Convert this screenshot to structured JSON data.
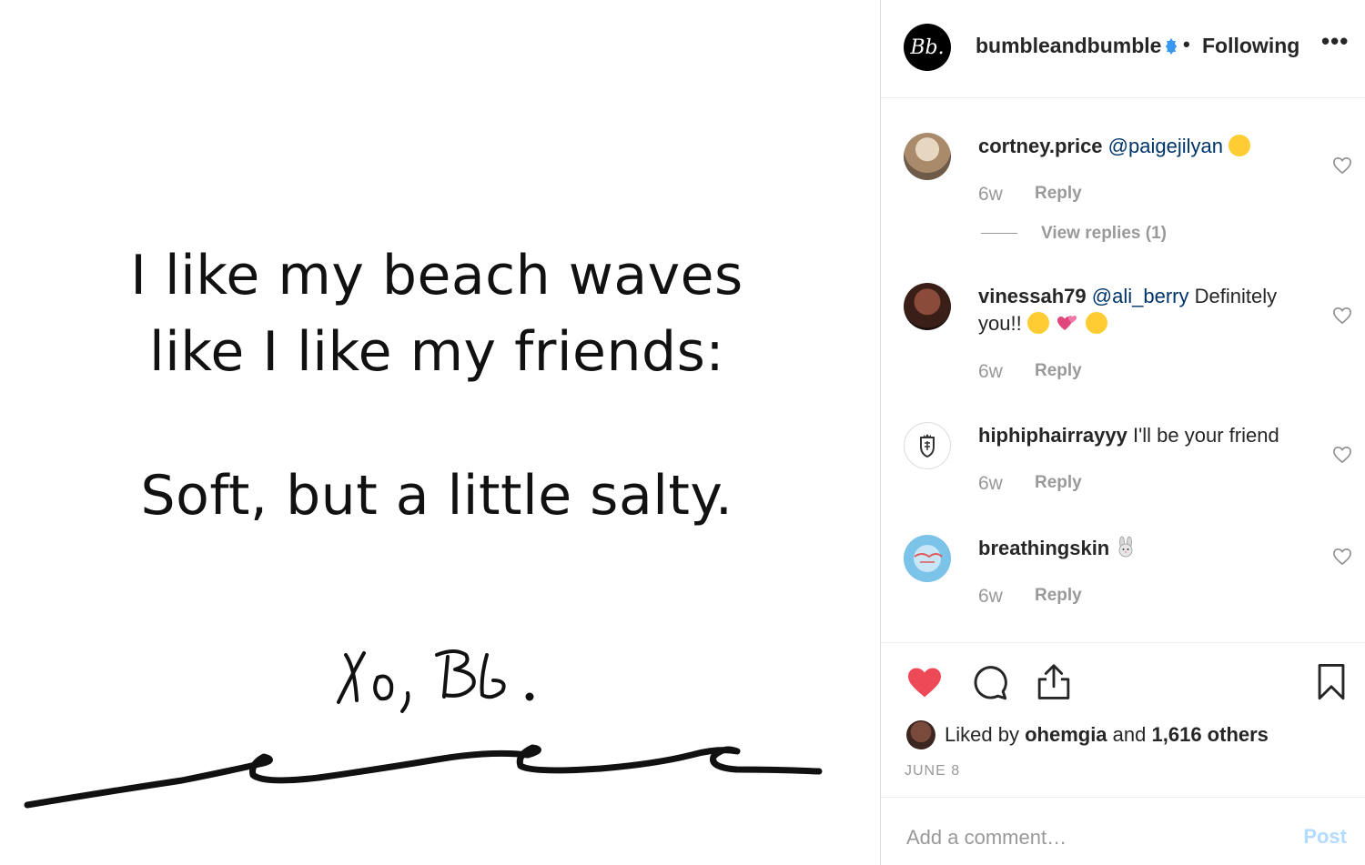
{
  "post_image": {
    "line1": "I like my beach waves",
    "line2": "like I like my friends:",
    "line3": "Soft, but a little salty.",
    "signature": "Xo, Bb."
  },
  "header": {
    "avatar_text": "Bb.",
    "username": "bumbleandbumble",
    "separator": "•",
    "follow_status": "Following",
    "more": "•••"
  },
  "comments": [
    {
      "username": "cortney.price",
      "mention": "@paigejilyan",
      "text": "",
      "emojis": [
        "kiss-face"
      ],
      "time": "6w",
      "reply": "Reply",
      "view_replies": "View replies (1)"
    },
    {
      "username": "vinessah79",
      "mention": "@ali_berry",
      "text": "Definitely you!!",
      "emojis": [
        "kissing-face",
        "two-hearts",
        "sweat-smile-face"
      ],
      "time": "6w",
      "reply": "Reply"
    },
    {
      "username": "hiphiphairrayyy",
      "mention": "",
      "text": "I'll be your friend",
      "emojis": [],
      "time": "6w",
      "reply": "Reply"
    },
    {
      "username": "breathingskin",
      "mention": "",
      "text": "",
      "emojis": [
        "rabbit-face"
      ],
      "time": "6w",
      "reply": "Reply"
    }
  ],
  "actions": {
    "liked_by_prefix": "Liked by",
    "liked_by_user": "ohemgia",
    "and": "and",
    "likes_others": "1,616 others",
    "date": "JUNE 8"
  },
  "add_comment": {
    "placeholder": "Add a comment…",
    "post_label": "Post"
  },
  "colors": {
    "like_red": "#ed4956",
    "mention_blue": "#003569",
    "verified_blue": "#3897f0",
    "post_disabled": "#b3dbff"
  }
}
